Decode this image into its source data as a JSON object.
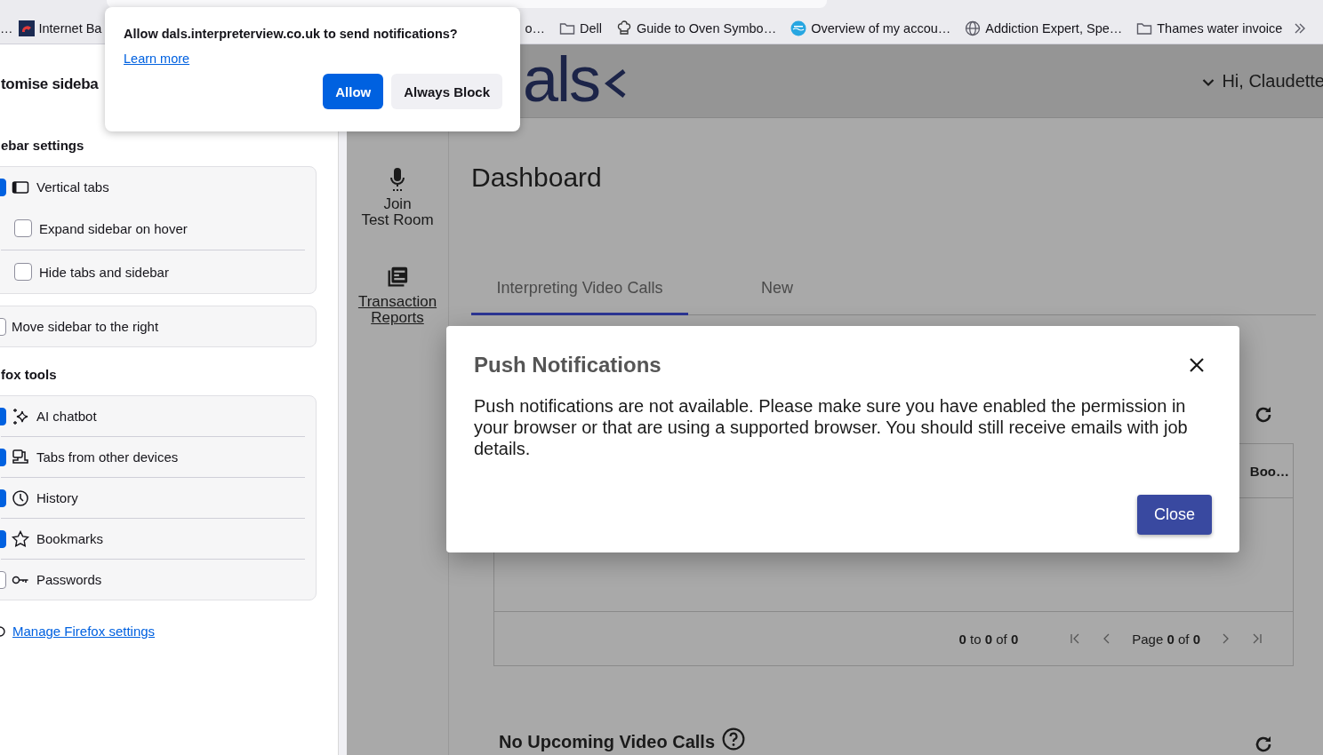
{
  "bookmarks_left": [
    {
      "label": "…"
    },
    {
      "label": "Internet Ba"
    }
  ],
  "bookmarks_right": [
    {
      "label": "o…"
    },
    {
      "label": "Dell"
    },
    {
      "label": "Guide to Oven Symbo…"
    },
    {
      "label": "Overview of my accou…"
    },
    {
      "label": "Addiction Expert, Spe…"
    },
    {
      "label": "Thames water invoice"
    }
  ],
  "sidebar_panel": {
    "title": "tomise sideba",
    "sections": [
      {
        "heading": "ebar settings",
        "groups": [
          {
            "items": [
              {
                "label": "Vertical tabs",
                "checked": true,
                "kind": "outer"
              },
              {
                "label": "Expand sidebar on hover",
                "checked": false,
                "kind": "nested"
              },
              {
                "label": "Hide tabs and sidebar",
                "checked": false,
                "kind": "nested"
              }
            ]
          },
          {
            "items": [
              {
                "label": "Move sidebar to the right",
                "checked": false,
                "kind": "outer"
              }
            ]
          }
        ]
      },
      {
        "heading": "fox tools",
        "groups": [
          {
            "items": [
              {
                "label": "AI chatbot",
                "checked": true,
                "kind": "outer"
              },
              {
                "label": "Tabs from other devices",
                "checked": true,
                "kind": "outer"
              },
              {
                "label": "History",
                "checked": true,
                "kind": "outer"
              },
              {
                "label": "Bookmarks",
                "checked": true,
                "kind": "outer"
              },
              {
                "label": "Passwords",
                "checked": false,
                "kind": "outer"
              }
            ]
          }
        ]
      }
    ],
    "link": "Manage Firefox settings"
  },
  "page": {
    "logo": "als",
    "greeting": "Hi, Claudette",
    "nav": [
      {
        "label": "Join\nTest Room",
        "link": false
      },
      {
        "label": "Transaction Reports",
        "link": true
      }
    ],
    "title": "Dashboard",
    "tabs": [
      {
        "label": "Interpreting Video Calls",
        "selected": true
      },
      {
        "label": "New",
        "selected": false
      }
    ],
    "table": {
      "column_header": "Boo…",
      "range": "**0** to **0** of **0**",
      "page": "Page **0** of **0**"
    },
    "upcoming_heading": "No Upcoming Video Calls"
  },
  "permission_popup": {
    "question": "Allow dals.interpreterview.co.uk to send notifications?",
    "link": "Learn more",
    "buttons": [
      {
        "label": "Allow",
        "kind": "primary"
      },
      {
        "label": "Always Block",
        "kind": "secondary"
      }
    ]
  },
  "modal": {
    "title": "Push Notifications",
    "body": "Push notifications are not available. Please make sure you have enabled the permission in your browser or that are using a supported browser. You should still receive emails with job details.",
    "button": "Close"
  }
}
